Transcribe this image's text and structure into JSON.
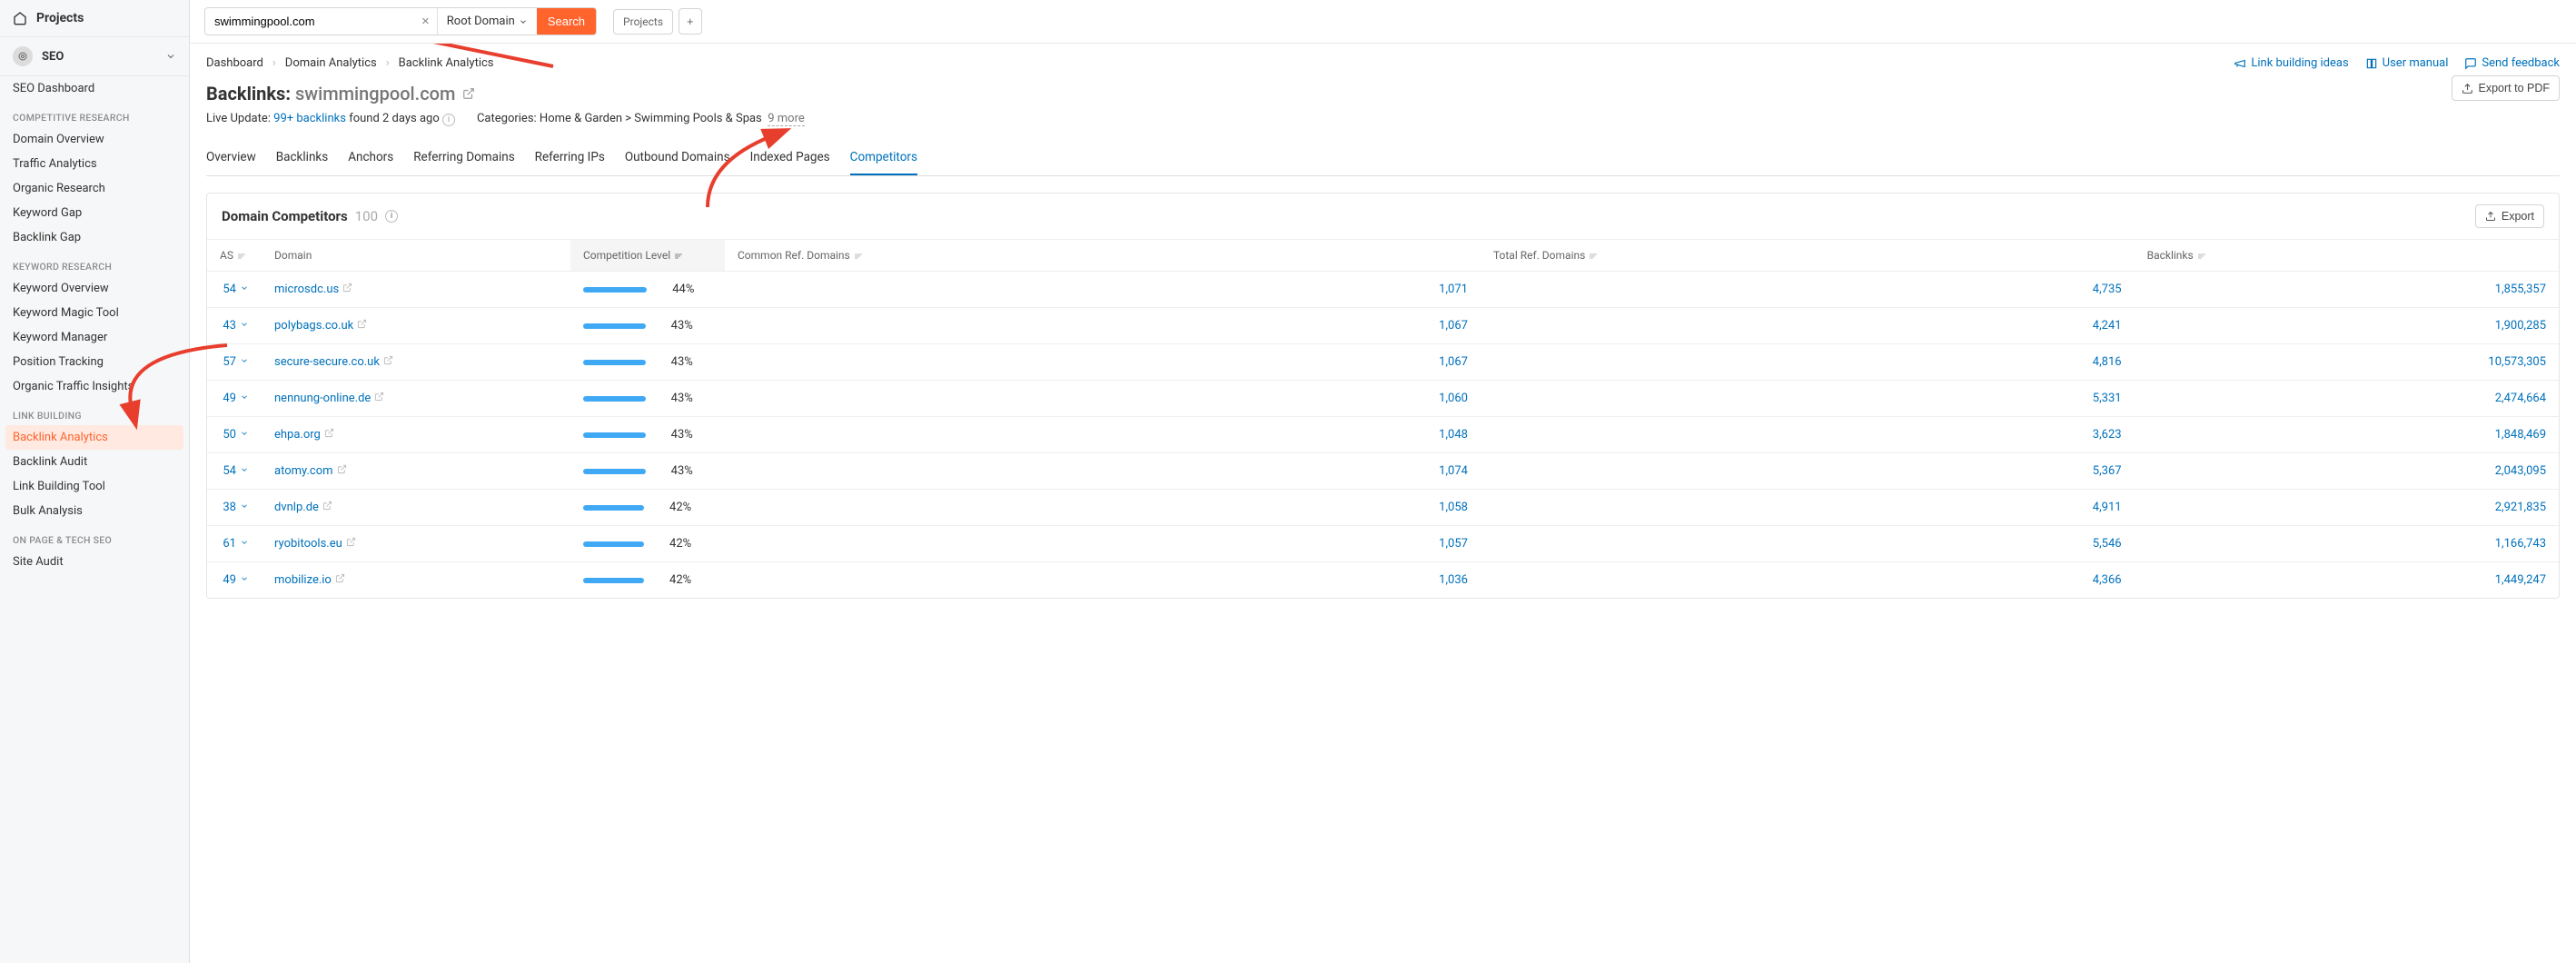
{
  "sidebar": {
    "header": "Projects",
    "section": "SEO",
    "groups": [
      {
        "items": [
          {
            "label": "SEO Dashboard"
          }
        ]
      },
      {
        "label": "COMPETITIVE RESEARCH",
        "items": [
          {
            "label": "Domain Overview"
          },
          {
            "label": "Traffic Analytics"
          },
          {
            "label": "Organic Research"
          },
          {
            "label": "Keyword Gap"
          },
          {
            "label": "Backlink Gap"
          }
        ]
      },
      {
        "label": "KEYWORD RESEARCH",
        "items": [
          {
            "label": "Keyword Overview"
          },
          {
            "label": "Keyword Magic Tool"
          },
          {
            "label": "Keyword Manager"
          },
          {
            "label": "Position Tracking"
          },
          {
            "label": "Organic Traffic Insights"
          }
        ]
      },
      {
        "label": "LINK BUILDING",
        "items": [
          {
            "label": "Backlink Analytics",
            "active": true
          },
          {
            "label": "Backlink Audit"
          },
          {
            "label": "Link Building Tool"
          },
          {
            "label": "Bulk Analysis"
          }
        ]
      },
      {
        "label": "ON PAGE & TECH SEO",
        "items": [
          {
            "label": "Site Audit"
          }
        ]
      }
    ]
  },
  "topbar": {
    "search_value": "swimmingpool.com",
    "scope": "Root Domain",
    "search_btn": "Search",
    "projects_chip": "Projects"
  },
  "breadcrumbs": [
    "Dashboard",
    "Domain Analytics",
    "Backlink Analytics"
  ],
  "header_actions": {
    "link_ideas": "Link building ideas",
    "user_manual": "User manual",
    "send_feedback": "Send feedback",
    "export_pdf": "Export to PDF"
  },
  "page": {
    "title_prefix": "Backlinks:",
    "domain": "swimmingpool.com",
    "live_update_pre": "Live Update:",
    "live_update_link": "99+ backlinks",
    "live_update_post": "found 2 days ago",
    "categories_label": "Categories:",
    "categories_text": "Home & Garden > Swimming Pools & Spas",
    "categories_more": "9 more"
  },
  "tabs": [
    "Overview",
    "Backlinks",
    "Anchors",
    "Referring Domains",
    "Referring IPs",
    "Outbound Domains",
    "Indexed Pages",
    "Competitors"
  ],
  "active_tab": "Competitors",
  "panel": {
    "title": "Domain Competitors",
    "count": "100",
    "export": "Export",
    "columns": {
      "as": "AS",
      "domain": "Domain",
      "comp": "Competition Level",
      "common": "Common Ref. Domains",
      "total": "Total Ref. Domains",
      "backlinks": "Backlinks"
    },
    "rows": [
      {
        "as": "54",
        "domain": "microsdc.us",
        "pct": "44%",
        "bar": 44,
        "common": "1,071",
        "total": "4,735",
        "backlinks": "1,855,357"
      },
      {
        "as": "43",
        "domain": "polybags.co.uk",
        "pct": "43%",
        "bar": 43,
        "common": "1,067",
        "total": "4,241",
        "backlinks": "1,900,285"
      },
      {
        "as": "57",
        "domain": "secure-secure.co.uk",
        "pct": "43%",
        "bar": 43,
        "common": "1,067",
        "total": "4,816",
        "backlinks": "10,573,305"
      },
      {
        "as": "49",
        "domain": "nennung-online.de",
        "pct": "43%",
        "bar": 43,
        "common": "1,060",
        "total": "5,331",
        "backlinks": "2,474,664"
      },
      {
        "as": "50",
        "domain": "ehpa.org",
        "pct": "43%",
        "bar": 43,
        "common": "1,048",
        "total": "3,623",
        "backlinks": "1,848,469"
      },
      {
        "as": "54",
        "domain": "atomy.com",
        "pct": "43%",
        "bar": 43,
        "common": "1,074",
        "total": "5,367",
        "backlinks": "2,043,095"
      },
      {
        "as": "38",
        "domain": "dvnlp.de",
        "pct": "42%",
        "bar": 42,
        "common": "1,058",
        "total": "4,911",
        "backlinks": "2,921,835"
      },
      {
        "as": "61",
        "domain": "ryobitools.eu",
        "pct": "42%",
        "bar": 42,
        "common": "1,057",
        "total": "5,546",
        "backlinks": "1,166,743"
      },
      {
        "as": "49",
        "domain": "mobilize.io",
        "pct": "42%",
        "bar": 42,
        "common": "1,036",
        "total": "4,366",
        "backlinks": "1,449,247"
      }
    ]
  }
}
